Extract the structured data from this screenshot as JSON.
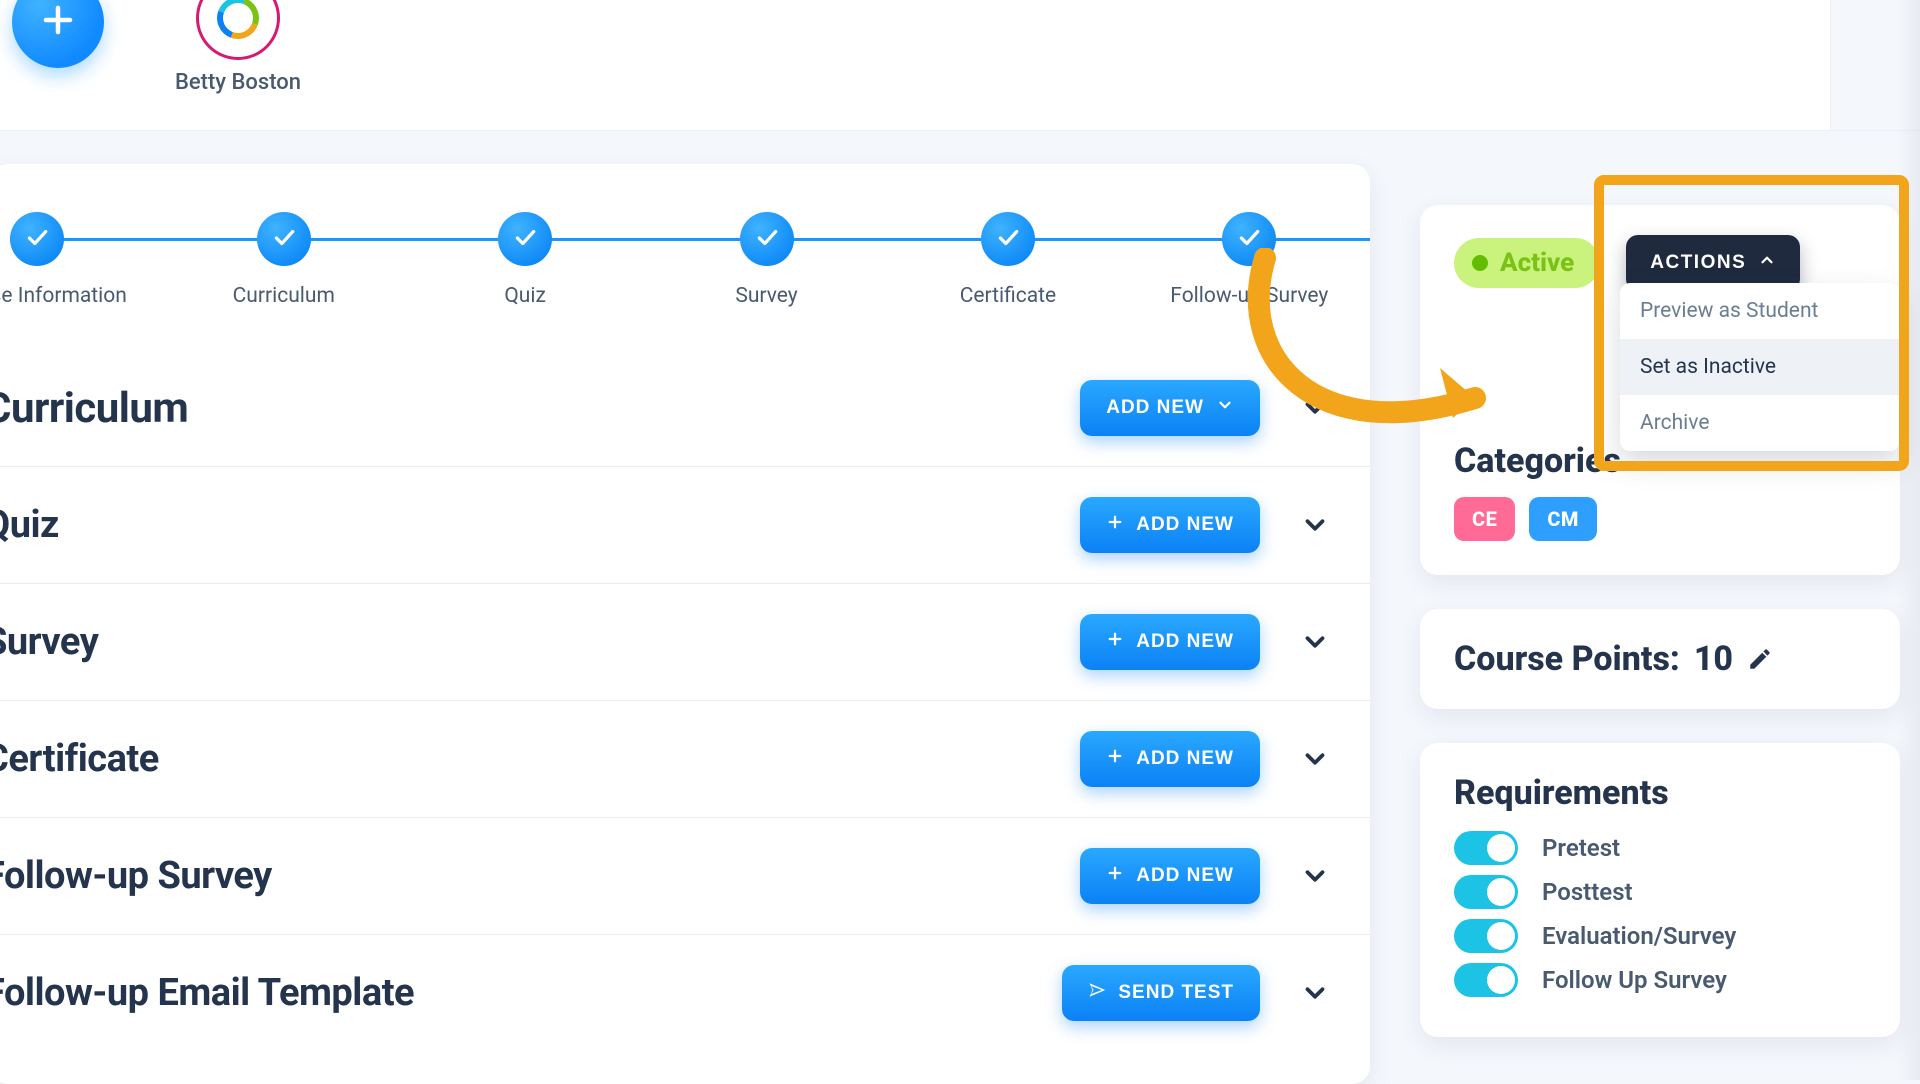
{
  "user": {
    "name": "Betty Boston"
  },
  "stepper": [
    {
      "label": "Course Information"
    },
    {
      "label": "Curriculum"
    },
    {
      "label": "Quiz"
    },
    {
      "label": "Survey"
    },
    {
      "label": "Certificate"
    },
    {
      "label": "Follow-up Survey"
    }
  ],
  "sections": {
    "curriculum": {
      "title": "Curriculum",
      "action": "ADD NEW"
    },
    "quiz": {
      "title": "Quiz",
      "action": "ADD NEW"
    },
    "survey": {
      "title": "Survey",
      "action": "ADD NEW"
    },
    "certificate": {
      "title": "Certificate",
      "action": "ADD NEW"
    },
    "followup": {
      "title": "Follow-up Survey",
      "action": "ADD NEW"
    },
    "emailtpl": {
      "title": "Follow-up Email Template",
      "action": "SEND TEST"
    }
  },
  "status": {
    "label": "Active",
    "actions_label": "ACTIONS",
    "menu": {
      "preview": "Preview as Student",
      "inactive": "Set as Inactive",
      "archive": "Archive"
    }
  },
  "categories": {
    "title": "Categories",
    "tags": {
      "ce": "CE",
      "cm": "CM"
    }
  },
  "points": {
    "label": "Course Points:",
    "value": "10"
  },
  "requirements": {
    "title": "Requirements",
    "items": {
      "pretest": "Pretest",
      "posttest": "Posttest",
      "eval": "Evaluation/Survey",
      "followup": "Follow Up Survey"
    }
  }
}
